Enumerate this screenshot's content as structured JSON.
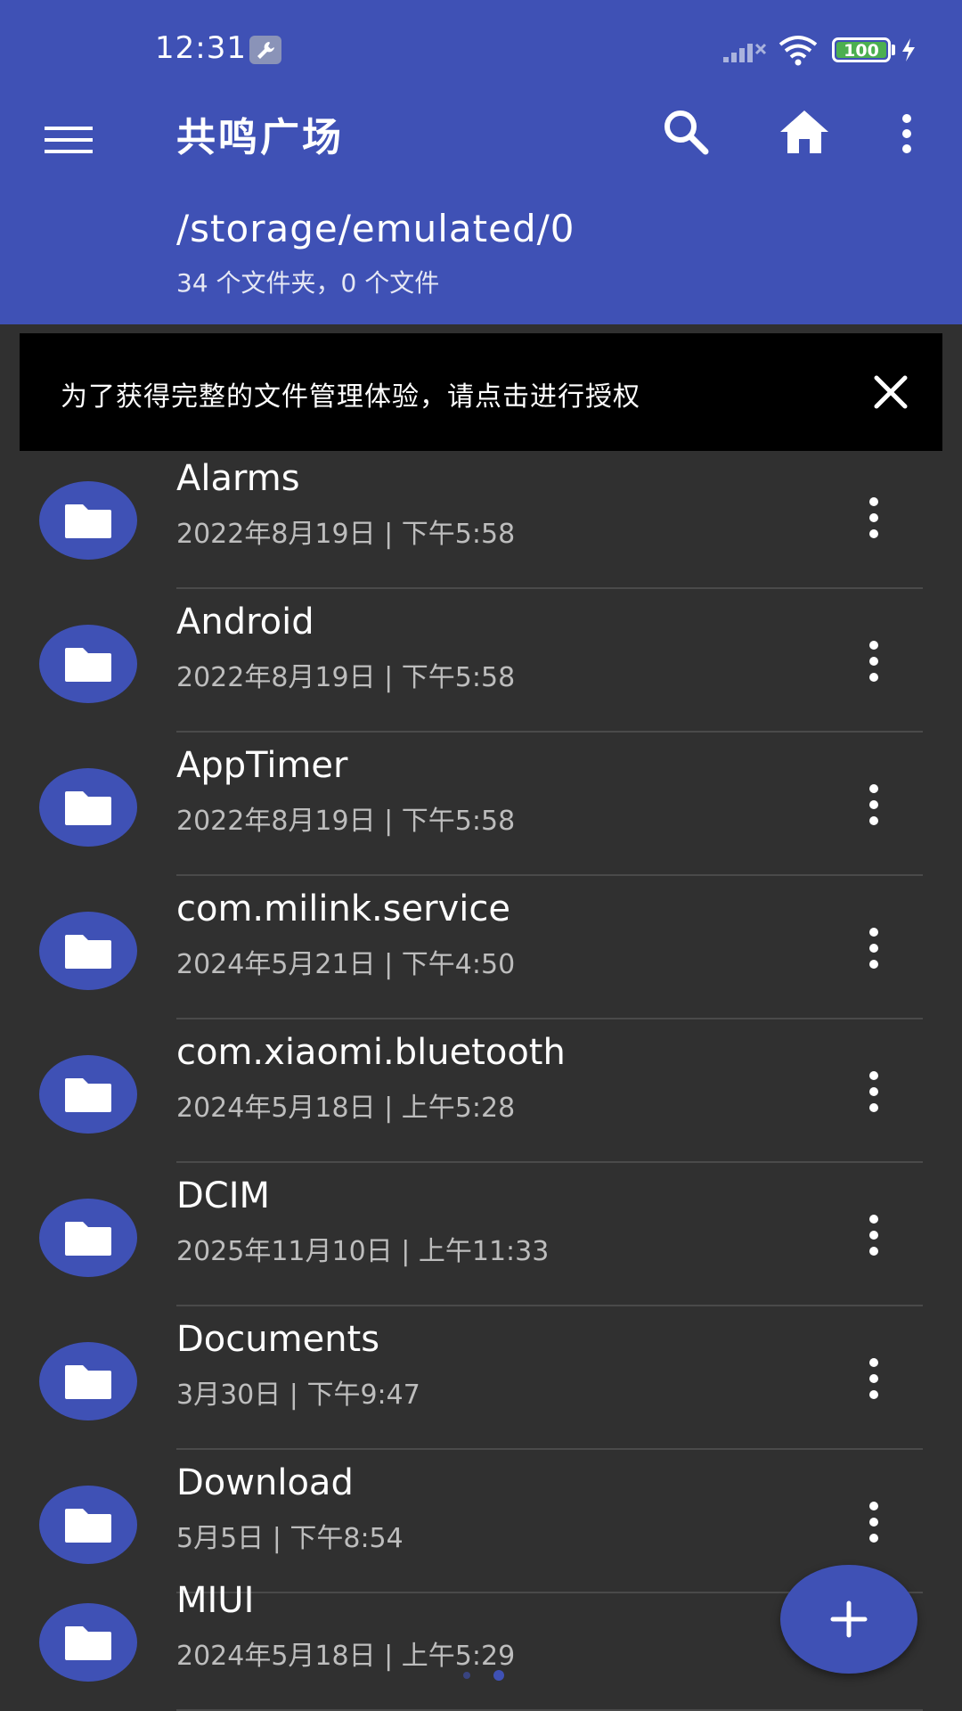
{
  "status_bar": {
    "time": "12:31",
    "battery": "100"
  },
  "toolbar": {
    "title": "共鸣广场"
  },
  "location": {
    "path": "/storage/emulated/0",
    "summary": "34 个文件夹，0 个文件"
  },
  "banner": {
    "text": "为了获得完整的文件管理体验，请点击进行授权"
  },
  "files": [
    {
      "name": "Alarms",
      "date": "2022年8月19日 | 下午5:58"
    },
    {
      "name": "Android",
      "date": "2022年8月19日 | 下午5:58"
    },
    {
      "name": "AppTimer",
      "date": "2022年8月19日 | 下午5:58"
    },
    {
      "name": "com.milink.service",
      "date": "2024年5月21日 | 下午4:50"
    },
    {
      "name": "com.xiaomi.bluetooth",
      "date": "2024年5月18日 | 上午5:28"
    },
    {
      "name": "DCIM",
      "date": "2025年11月10日 | 上午11:33"
    },
    {
      "name": "Documents",
      "date": "3月30日 | 下午9:47"
    },
    {
      "name": "Download",
      "date": "5月5日 | 下午8:54"
    },
    {
      "name": "MIUI",
      "date": "2024年5月18日 | 上午5:29"
    }
  ],
  "colors": {
    "primary": "#3f51b5",
    "background": "#303030",
    "banner": "#000000",
    "battery": "#4caf50"
  },
  "icons": {
    "menu": "menu-icon",
    "search": "search-icon",
    "home": "home-icon",
    "more": "more-vert-icon",
    "close": "close-icon",
    "folder": "folder-icon",
    "add": "add-icon"
  }
}
